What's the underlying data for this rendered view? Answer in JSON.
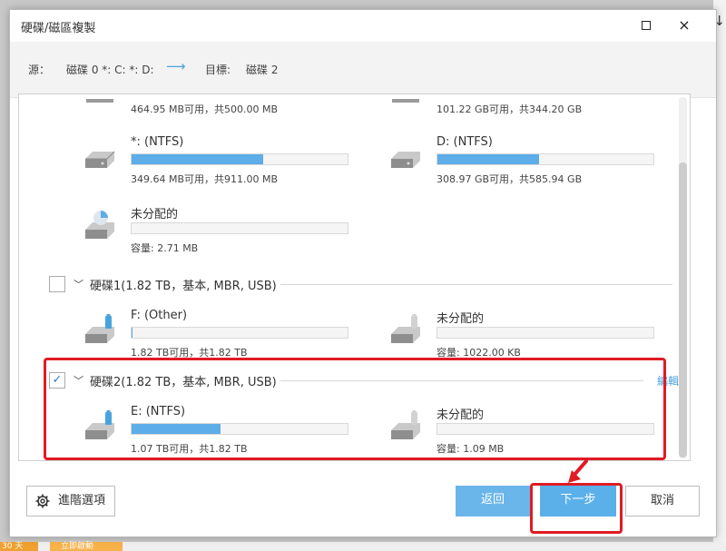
{
  "window": {
    "title": "硬碟/磁區複製",
    "maximize_label": "",
    "close_label": "×"
  },
  "source_bar": {
    "source_label": "源：",
    "source_value": "磁碟 0 *: C: *: D:",
    "arrow": "⟶",
    "target_label": "目標:",
    "target_value": "磁碟 2"
  },
  "partitions_top": [
    {
      "info": "464.95 MB可用，共500.00 MB"
    },
    {
      "info": "101.22 GB可用，共344.20 GB"
    }
  ],
  "disk0_partitions": [
    {
      "name": "*: (NTFS)",
      "fill": 0.61,
      "info": "349.64 MB可用，共911.00 MB",
      "icon": "hard-drive-icon"
    },
    {
      "name": "D: (NTFS)",
      "fill": 0.47,
      "info": "308.97 GB可用，共585.94 GB",
      "icon": "hard-drive-icon"
    },
    {
      "name": "未分配的",
      "fill": 0.0,
      "info": "容量: 2.71 MB",
      "icon": "unallocated-drive-icon"
    }
  ],
  "disk1": {
    "name": "硬碟1(1.82 TB，基本, MBR, USB)",
    "checked": false,
    "partitions": [
      {
        "name": "F: (Other)",
        "fill": 0.005,
        "info": "1.82 TB可用，共1.82 TB",
        "icon": "usb-drive-icon"
      },
      {
        "name": "未分配的",
        "fill": 0.0,
        "info": "容量: 1022.00 KB",
        "icon": "usb-drive-unallocated-icon"
      }
    ]
  },
  "disk2": {
    "name": "硬碟2(1.82 TB，基本, MBR, USB)",
    "checked": true,
    "check_mark": "✓",
    "edit_label": "編輯",
    "partitions": [
      {
        "name": "E: (NTFS)",
        "fill": 0.41,
        "info": "1.07 TB可用，共1.82 TB",
        "icon": "usb-drive-icon"
      },
      {
        "name": "未分配的",
        "fill": 0.0,
        "info": "容量: 1.09 MB",
        "icon": "usb-drive-unallocated-icon"
      }
    ]
  },
  "footer": {
    "advanced_label": "進階選項",
    "back_label": "返回",
    "next_label": "下一步",
    "cancel_label": "取消"
  },
  "background": {
    "badge_text": "30 天",
    "button_text": "立即啟動"
  },
  "colors": {
    "accent": "#5dade8",
    "highlight_red": "#e01b24"
  }
}
